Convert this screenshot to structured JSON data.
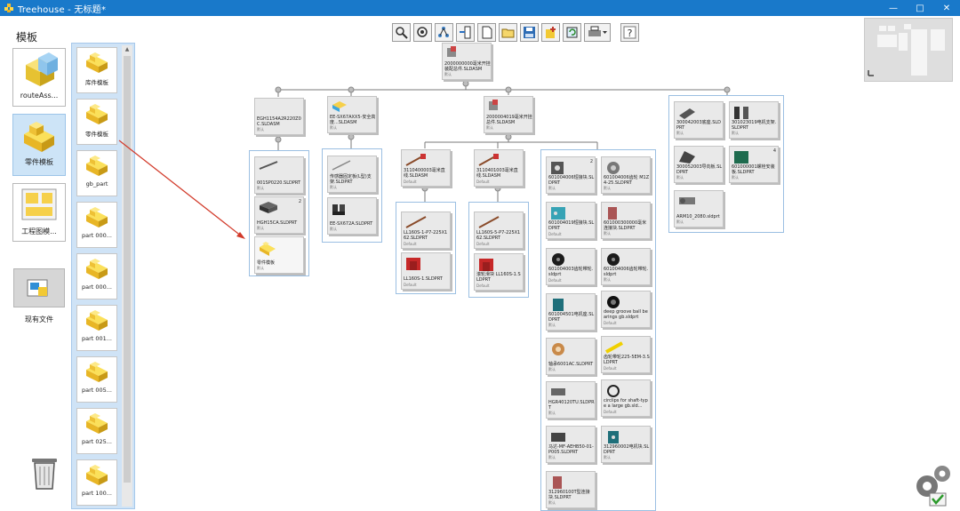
{
  "window": {
    "title": "Treehouse - 无标题*",
    "minimize": "—",
    "maximize": "□",
    "close": "✕"
  },
  "left": {
    "heading": "模板",
    "categories": [
      {
        "label": "routeAss...",
        "icon": "assembly-icon"
      },
      {
        "label": "零件模板",
        "icon": "part-template-icon",
        "selected": true
      },
      {
        "label": "工程图模...",
        "icon": "drawing-template-icon"
      },
      {
        "label": "现有文件",
        "icon": "existing-file-icon"
      }
    ],
    "templates": [
      "库件模板",
      "零件模板",
      "gb_part",
      "part 000...",
      "part 000...",
      "part 001...",
      "part 005...",
      "part 025...",
      "part 100..."
    ]
  },
  "toolbar": {
    "buttons": [
      "zoom-icon",
      "zoom-fit-icon",
      "tree-layout-icon",
      "insert-icon",
      "new-document-icon",
      "open-folder-icon",
      "save-icon",
      "add-node-icon",
      "refresh-icon",
      "print-icon",
      "help-icon"
    ]
  },
  "tree": {
    "root": {
      "name": "2000000000毫米开挂装配总件.SLDASM",
      "sub": "默认"
    },
    "level1": [
      {
        "name": "EGH1154A2R220Z0C.SLDASM",
        "sub": "默认"
      },
      {
        "name": "EE-SX67AXX5-安全高度...SLDASM",
        "sub": "默认"
      },
      {
        "name": "2000004019毫米开挂总件.SLDASM",
        "sub": "默认"
      },
      {
        "name": "",
        "sub": ""
      }
    ],
    "g1": [
      {
        "name": "001SP0220.SLDPRT",
        "sub": "默认"
      },
      {
        "name": "HGH15CA.SLDPRT",
        "sub": "默认",
        "count": "2"
      },
      {
        "name": "零件模板",
        "sub": "默认",
        "selected": true
      }
    ],
    "g2": [
      {
        "name": "传感器固定板(L型)支架.SLDPRT",
        "sub": "默认"
      },
      {
        "name": "EE-SX672A.SLDPRT",
        "sub": "默认"
      }
    ],
    "g3": [
      {
        "name": "3110400003毫米直线.SLDASM",
        "sub": "Default"
      },
      {
        "name": "3110401003毫米直线.SLDASM",
        "sub": "Default"
      }
    ],
    "g3a": [
      {
        "name": "LL160S-1-P7-225X162.SLDPRT",
        "sub": "Default"
      },
      {
        "name": "LL160S-1.SLDPRT",
        "sub": "Default"
      }
    ],
    "g3b": [
      {
        "name": "LL160S-5-P7-225X162.SLDPRT",
        "sub": "Default"
      },
      {
        "name": "滚轮滑块 LL160S-1.SLDPRT",
        "sub": "Default"
      }
    ],
    "g4": [
      {
        "name": "601004006短接块.SLDPRT",
        "sub": "默认",
        "count": "2"
      },
      {
        "name": "601004006齿轮 M1Z4-25.SLDPRT",
        "sub": "默认"
      },
      {
        "name": "601004019短接块.SLDPRT",
        "sub": "Default"
      },
      {
        "name": "601000300000毫米连接块.SLDPRT",
        "sub": "默认"
      },
      {
        "name": "601004003齿轮带轮.sldprt",
        "sub": "Default"
      },
      {
        "name": "601004006齿轮带轮.sldprt",
        "sub": "默认"
      },
      {
        "name": "601004501电机座.SLDPRT",
        "sub": "默认"
      },
      {
        "name": "deep groove ball bearings gb.sldprt",
        "sub": "Default"
      },
      {
        "name": "轴承6001AC.SLDPRT",
        "sub": "默认"
      },
      {
        "name": "齿轮带轮225-5EM-3.SLDPRT",
        "sub": "Default"
      },
      {
        "name": "HGR40120TU.SLDPRT",
        "sub": "默认"
      },
      {
        "name": "circlips for shaft-type a large gb.sld...",
        "sub": "Default"
      },
      {
        "name": "马达-MF-AEHB50-01-P005.SLDPRT",
        "sub": "默认"
      },
      {
        "name": "312960002电机块.SLDPRT",
        "sub": "默认"
      },
      {
        "name": "312960100T型连接块.SLDPRT",
        "sub": "默认"
      }
    ],
    "g5": [
      {
        "name": "300042003底座.SLDPRT",
        "sub": "默认"
      },
      {
        "name": "301023019电机支架.SLDPRT",
        "sub": "默认"
      },
      {
        "name": "300052003导向板.SLDPRT",
        "sub": "默认"
      },
      {
        "name": "601000001螺栓安装板.SLDPRT",
        "sub": "默认",
        "count": "4"
      },
      {
        "name": "ARM10_2080.sldprt",
        "sub": "默认"
      }
    ]
  }
}
